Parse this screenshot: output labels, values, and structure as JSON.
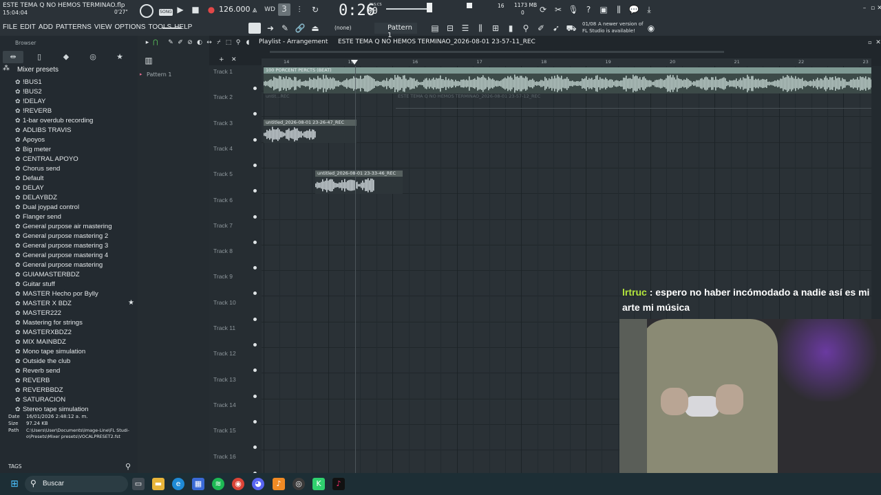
{
  "window": {
    "title": "ESTE TEMA Q NO HEMOS TERMINAO.flp",
    "clock": "15:04:04",
    "hint_time": "0'27\"",
    "song_badge": "SONG"
  },
  "transport": {
    "bpm": "126.000",
    "time": "0:26",
    "time_small": "90",
    "msc": "M:S:CS",
    "memory": "1173 MB",
    "cpu_top": "16",
    "cpu_bottom": "0"
  },
  "menu": [
    "FILE",
    "EDIT",
    "ADD",
    "PATTERNS",
    "VIEW",
    "OPTIONS",
    "TOOLS",
    "HELP"
  ],
  "toolbar": {
    "pattern": "Pattern 1",
    "none_label": "(none)",
    "news_date": "01/08",
    "news_text1": "A newer version of",
    "news_text2": "FL Studio is available!"
  },
  "browser": {
    "title": "Browser",
    "folder": "Mixer presets",
    "items": [
      "!BUS1",
      "!BUS2",
      "!DELAY",
      "!REVERB",
      "1-bar overdub recording",
      "ADLIBS TRAVIS",
      "Apoyos",
      "Big meter",
      "CENTRAL APOYO",
      "Chorus send",
      "Default",
      "DELAY",
      "DELAYBDZ",
      "Dual joypad control",
      "Flanger send",
      "General purpose air mastering",
      "General purpose mastering 2",
      "General purpose mastering 3",
      "General purpose mastering 4",
      "General purpose mastering",
      "GUIAMASTERBDZ",
      "Guitar stuff",
      "MASTER Hecho por Bylly",
      "MASTER X BDZ",
      "MASTER222",
      "Mastering for strings",
      "MASTERXBDZ2",
      "MIX MAINBDZ",
      "Mono tape simulation",
      "Outside the club",
      "Reverb send",
      "REVERB",
      "REVERBBDZ",
      "SATURACION",
      "Stereo tape simulation"
    ],
    "info": {
      "date_label": "Date",
      "date": "16/01/2026 2:48:12 a. m.",
      "size_label": "Size",
      "size": "97.24 KB",
      "path_label": "Path",
      "path1": "C:\\Users\\User\\Documents\\Image-Line\\FL Studi-",
      "path2": "o\\Presets\\Mixer presets\\VOCALPRESET2.fst"
    },
    "tags": "TAGS"
  },
  "patterns": {
    "item": "Pattern 1"
  },
  "playlist": {
    "title": "Playlist - Arrangement",
    "file": "ESTE TEMA Q NO HEMOS TERMINAO_2026-08-01 23-57-11_REC",
    "ruler": [
      "14",
      "15",
      "16",
      "17",
      "18",
      "19",
      "20",
      "21",
      "22",
      "23"
    ],
    "tracks": [
      "Track 1",
      "Track 2",
      "Track 3",
      "Track 4",
      "Track 5",
      "Track 6",
      "Track 7",
      "Track 8",
      "Track 9",
      "Track 10",
      "Track 11",
      "Track 12",
      "Track 13",
      "Track 14",
      "Track 15",
      "Track 16"
    ],
    "clips": {
      "beat": "100 PORCENT PERCTS (BEAT)",
      "t2a": "untit...REC",
      "t2b": "ESTE TEMA Q NO HEMOS TERMINAO_2026-08-01 23-57-12_REC",
      "t3": "untitled_2026-08-01 23-26-47_REC",
      "t5": "untitled_2026-08-01 23-33-46_REC"
    }
  },
  "chat": {
    "user": "lrtruc",
    "sep": ":",
    "message": "espero no haber incómodado a nadie así es mi arte mi música"
  },
  "taskbar": {
    "search": "Buscar"
  },
  "colors": {
    "chat_user": "#b4e63c",
    "clip_green": "#7f9a94",
    "grid": "#2a3136"
  }
}
